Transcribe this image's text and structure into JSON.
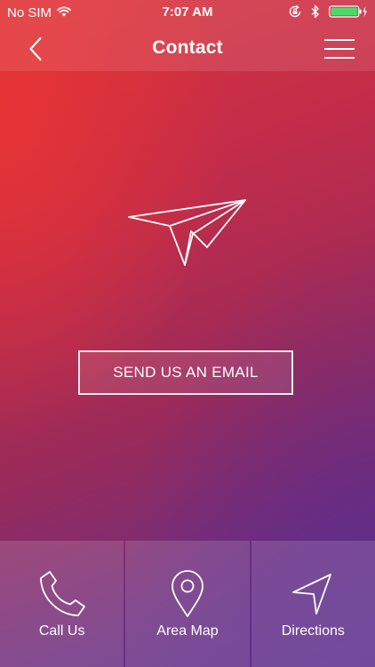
{
  "status_bar": {
    "carrier": "No SIM",
    "time": "7:07 AM"
  },
  "nav": {
    "title": "Contact"
  },
  "main": {
    "email_button_label": "SEND US AN EMAIL"
  },
  "tabs": [
    {
      "label": "Call Us",
      "icon": "phone-icon"
    },
    {
      "label": "Area Map",
      "icon": "map-pin-icon"
    },
    {
      "label": "Directions",
      "icon": "navigation-arrow-icon"
    }
  ],
  "colors": {
    "gradient_top_left": "#e83434",
    "gradient_bottom_right": "#5c2f8c",
    "battery_green": "#4cd964",
    "text": "#ffffff"
  }
}
